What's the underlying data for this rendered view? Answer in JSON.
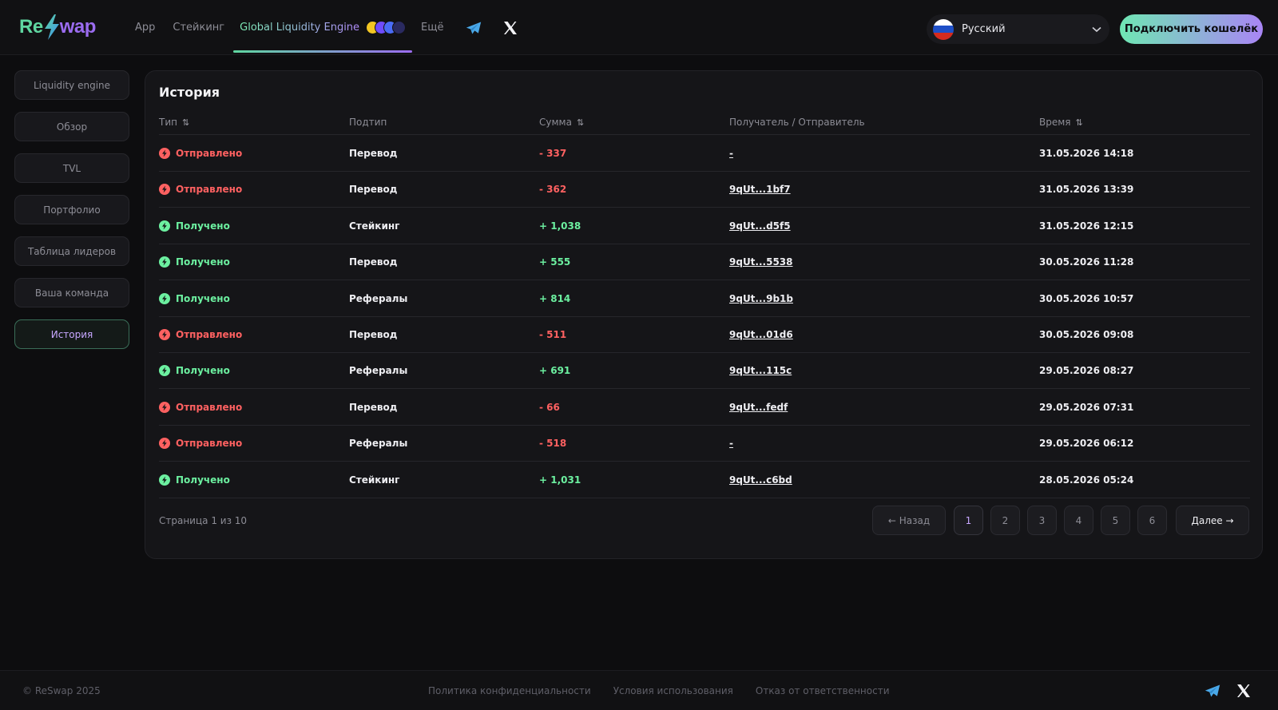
{
  "header": {
    "logo_left": "Re",
    "logo_right": "wap",
    "nav": [
      {
        "label": "App"
      },
      {
        "label": "Стейкинг"
      },
      {
        "label": "Global Liquidity Engine"
      },
      {
        "label": "Ещё"
      }
    ],
    "language": "Русский",
    "connect_label": "Подключить кошелёк"
  },
  "sidebar": {
    "items": [
      {
        "label": "Liquidity engine"
      },
      {
        "label": "Обзор"
      },
      {
        "label": "TVL"
      },
      {
        "label": "Портфолио"
      },
      {
        "label": "Таблица лидеров"
      },
      {
        "label": "Ваша команда"
      },
      {
        "label": "История"
      }
    ],
    "active_index": 6
  },
  "history": {
    "title": "История",
    "columns": {
      "type": "Тип",
      "subtype": "Подтип",
      "amount": "Сумма",
      "party": "Получатель / Отправитель",
      "time": "Время"
    },
    "sort_glyph": "⇅",
    "rows": [
      {
        "type": "Отправлено",
        "status": "sent",
        "subtype": "Перевод",
        "amount": "- 337",
        "party": "-",
        "time": "31.05.2026 14:18"
      },
      {
        "type": "Отправлено",
        "status": "sent",
        "subtype": "Перевод",
        "amount": "- 362",
        "party": "9qUt...1bf7",
        "time": "31.05.2026 13:39"
      },
      {
        "type": "Получено",
        "status": "recv",
        "subtype": "Стейкинг",
        "amount": "+ 1,038",
        "party": "9qUt...d5f5",
        "time": "31.05.2026 12:15"
      },
      {
        "type": "Получено",
        "status": "recv",
        "subtype": "Перевод",
        "amount": "+ 555",
        "party": "9qUt...5538",
        "time": "30.05.2026 11:28"
      },
      {
        "type": "Получено",
        "status": "recv",
        "subtype": "Рефералы",
        "amount": "+ 814",
        "party": "9qUt...9b1b",
        "time": "30.05.2026 10:57"
      },
      {
        "type": "Отправлено",
        "status": "sent",
        "subtype": "Перевод",
        "amount": "- 511",
        "party": "9qUt...01d6",
        "time": "30.05.2026 09:08"
      },
      {
        "type": "Получено",
        "status": "recv",
        "subtype": "Рефералы",
        "amount": "+ 691",
        "party": "9qUt...115c",
        "time": "29.05.2026 08:27"
      },
      {
        "type": "Отправлено",
        "status": "sent",
        "subtype": "Перевод",
        "amount": "- 66",
        "party": "9qUt...fedf",
        "time": "29.05.2026 07:31"
      },
      {
        "type": "Отправлено",
        "status": "sent",
        "subtype": "Рефералы",
        "amount": "- 518",
        "party": "-",
        "time": "29.05.2026 06:12"
      },
      {
        "type": "Получено",
        "status": "recv",
        "subtype": "Стейкинг",
        "amount": "+ 1,031",
        "party": "9qUt...c6bd",
        "time": "28.05.2026 05:24"
      }
    ],
    "pagination": {
      "info": "Страница 1 из 10",
      "prev": "← Назад",
      "next": "Далее →",
      "pages": [
        "1",
        "2",
        "3",
        "4",
        "5",
        "6"
      ],
      "current": "1"
    }
  },
  "footer": {
    "copyright": "© ReSwap 2025",
    "links": [
      "Политика конфиденциальности",
      "Условия использования",
      "Отказ от ответственности"
    ]
  },
  "colors": {
    "sent": "#ff6161",
    "received": "#6cf0a0",
    "accent_green": "#6fe7b3",
    "accent_purple": "#a985f5"
  },
  "icons": {
    "sent": "lightning-red-icon",
    "received": "lightning-green-icon",
    "social": [
      "telegram-icon",
      "x-icon"
    ]
  }
}
